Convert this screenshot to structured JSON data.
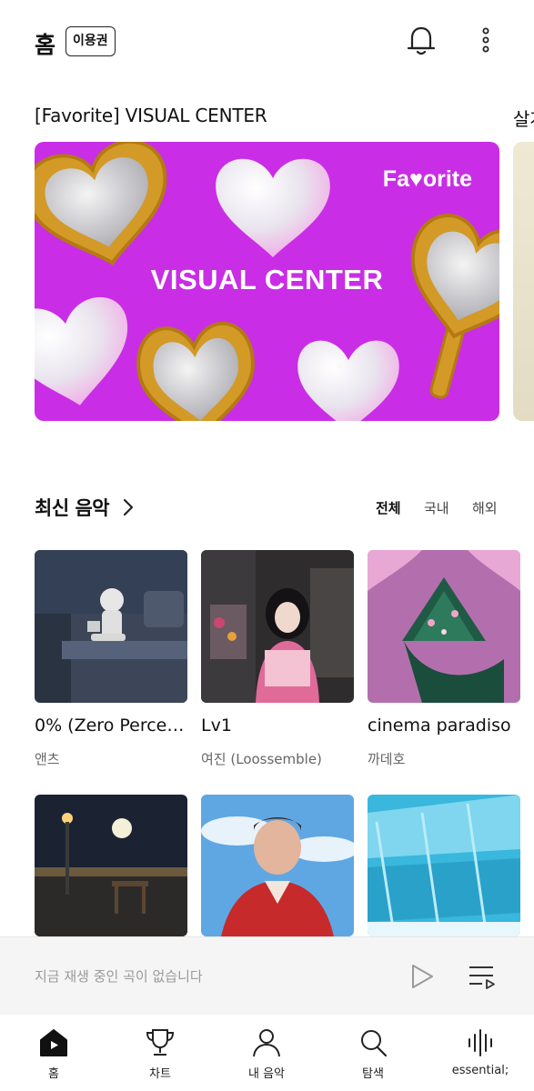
{
  "header": {
    "title": "홈",
    "pass_badge": "이용권"
  },
  "banner": {
    "section_title": "[Favorite] VISUAL CENTER",
    "next_title": "살개",
    "brand": "Fa♥orite",
    "headline": "VISUAL CENTER",
    "bg_color": "#c92ee6"
  },
  "latest": {
    "title": "최신 음악",
    "filters": [
      "전체",
      "국내",
      "해외"
    ],
    "selected_filter": "전체",
    "albums": [
      {
        "name": "0% (Zero Perce…",
        "artist": "앤츠"
      },
      {
        "name": "Lv1",
        "artist": "여진 (Loossemble)"
      },
      {
        "name": "cinema paradiso",
        "artist": "까데호"
      },
      {
        "name": "",
        "artist": ""
      },
      {
        "name": "",
        "artist": ""
      },
      {
        "name": "",
        "artist": ""
      }
    ]
  },
  "player": {
    "empty_message": "지금 재생 중인 곡이 없습니다"
  },
  "nav": {
    "items": [
      {
        "label": "홈",
        "icon": "home-icon"
      },
      {
        "label": "차트",
        "icon": "trophy-icon"
      },
      {
        "label": "내 음악",
        "icon": "person-icon"
      },
      {
        "label": "탐색",
        "icon": "search-icon"
      },
      {
        "label": "essential;",
        "icon": "waveform-icon"
      }
    ]
  }
}
